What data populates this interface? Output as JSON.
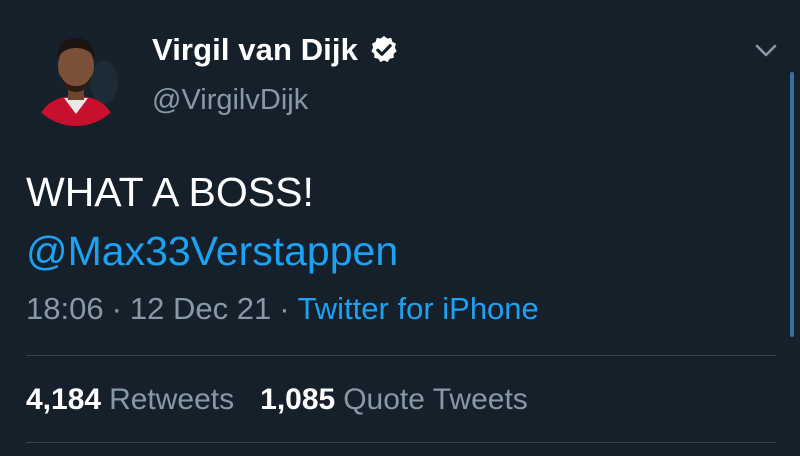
{
  "tweet": {
    "author_name": "Virgil van Dijk",
    "author_handle": "@VirgilvDijk",
    "verified_icon": "verified-badge-icon",
    "text_line1": "WHAT A BOSS!",
    "mention": "@Max33Verstappen",
    "time": "18:06",
    "date": "12 Dec 21",
    "separator": "·",
    "source": "Twitter for iPhone"
  },
  "stats": {
    "retweets_count": "4,184",
    "retweets_label": "Retweets",
    "quotes_count": "1,085",
    "quotes_label": "Quote Tweets"
  },
  "icons": {
    "menu": "chevron-down-icon"
  },
  "colors": {
    "background": "#15202b",
    "text": "#ffffff",
    "secondary": "#8899a6",
    "accent": "#1da1f2",
    "divider": "#38444d",
    "jersey": "#c8102e"
  }
}
